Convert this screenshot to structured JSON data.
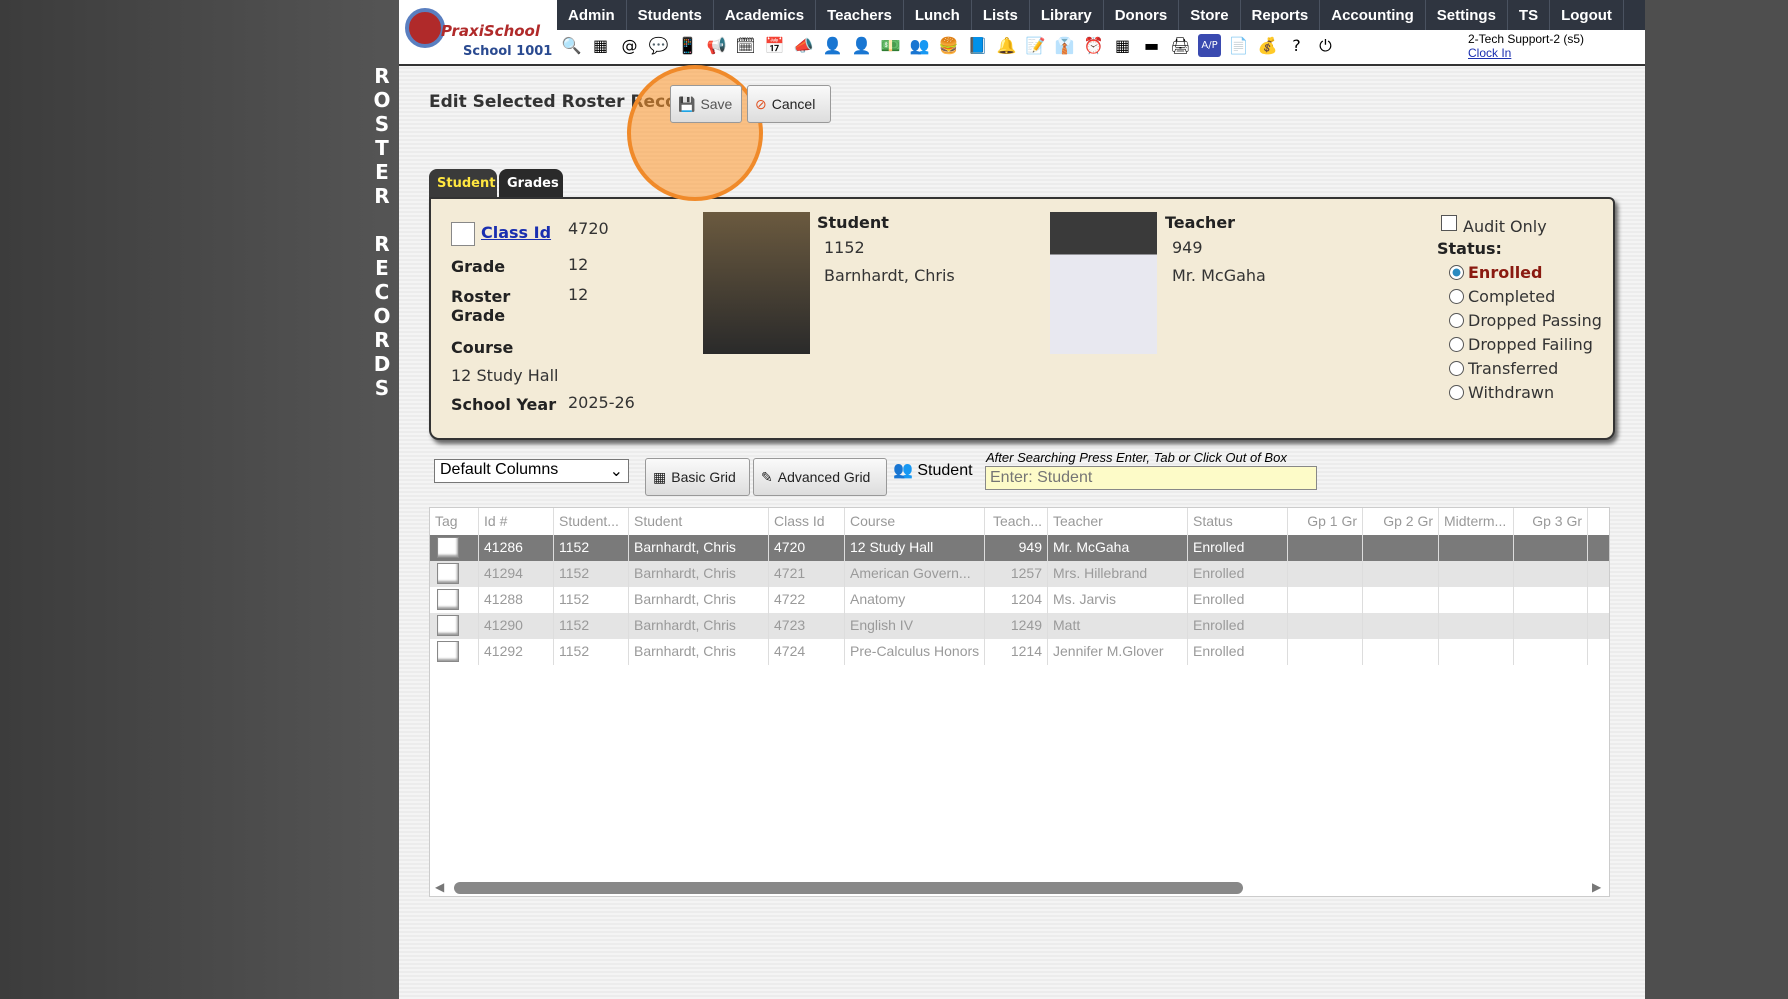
{
  "side_label": [
    "R",
    "O",
    "S",
    "T",
    "E",
    "R",
    " ",
    "R",
    "E",
    "C",
    "O",
    "R",
    "D",
    "S"
  ],
  "logo": {
    "brand": "PraxiSchool",
    "school": "School 1001"
  },
  "nav": [
    "Admin",
    "Students",
    "Academics",
    "Teachers",
    "Lunch",
    "Lists",
    "Library",
    "Donors",
    "Store",
    "Reports",
    "Accounting",
    "Settings",
    "TS",
    "Logout"
  ],
  "user": {
    "name": "2-Tech Support-2 (s5)",
    "clock_in": "Clock In"
  },
  "title": "Edit Selected Roster Record",
  "save": "Save",
  "cancel": "Cancel",
  "tabs": [
    "Student",
    "Grades"
  ],
  "record": {
    "class_id_label": "Class Id",
    "class_id": "4720",
    "grade_label": "Grade",
    "grade": "12",
    "roster_grade_label": "Roster Grade",
    "roster_grade": "12",
    "course_label": "Course",
    "course": "12 Study Hall",
    "year_label": "School Year",
    "year": "2025-26",
    "student_label": "Student",
    "student_id": "1152",
    "student_name": "Barnhardt, Chris",
    "teacher_label": "Teacher",
    "teacher_id": "949",
    "teacher_name": "Mr. McGaha",
    "audit_only": "Audit Only",
    "status_label": "Status:",
    "statuses": [
      "Enrolled",
      "Completed",
      "Dropped Passing",
      "Dropped Failing",
      "Transferred",
      "Withdrawn"
    ],
    "selected_status": "Enrolled"
  },
  "toolbar": {
    "columns": "Default Columns",
    "basic": "Basic Grid",
    "advanced": "Advanced Grid",
    "student": "Student",
    "hint": "After Searching Press Enter, Tab or Click Out of Box",
    "placeholder": "Enter: Student"
  },
  "grid": {
    "headers": [
      "Tag",
      "Id #",
      "Student...",
      "Student",
      "Class Id",
      "Course",
      "Teach...",
      "Teacher",
      "Status",
      "Gp 1 Gr",
      "Gp 2 Gr",
      "Midterm...",
      "Gp 3 Gr"
    ],
    "rows": [
      [
        "",
        "41286",
        "1152",
        "Barnhardt, Chris",
        "4720",
        "12 Study Hall",
        "949",
        "Mr. McGaha",
        "Enrolled",
        "",
        "",
        "",
        ""
      ],
      [
        "",
        "41294",
        "1152",
        "Barnhardt, Chris",
        "4721",
        "American Govern...",
        "1257",
        "Mrs. Hillebrand",
        "Enrolled",
        "",
        "",
        "",
        ""
      ],
      [
        "",
        "41288",
        "1152",
        "Barnhardt, Chris",
        "4722",
        "Anatomy",
        "1204",
        "Ms. Jarvis",
        "Enrolled",
        "",
        "",
        "",
        ""
      ],
      [
        "",
        "41290",
        "1152",
        "Barnhardt, Chris",
        "4723",
        "English IV",
        "1249",
        "Matt",
        "Enrolled",
        "",
        "",
        "",
        ""
      ],
      [
        "",
        "41292",
        "1152",
        "Barnhardt, Chris",
        "4724",
        "Pre-Calculus Honors",
        "1214",
        "Jennifer M.Glover",
        "Enrolled",
        "",
        "",
        "",
        ""
      ]
    ]
  }
}
